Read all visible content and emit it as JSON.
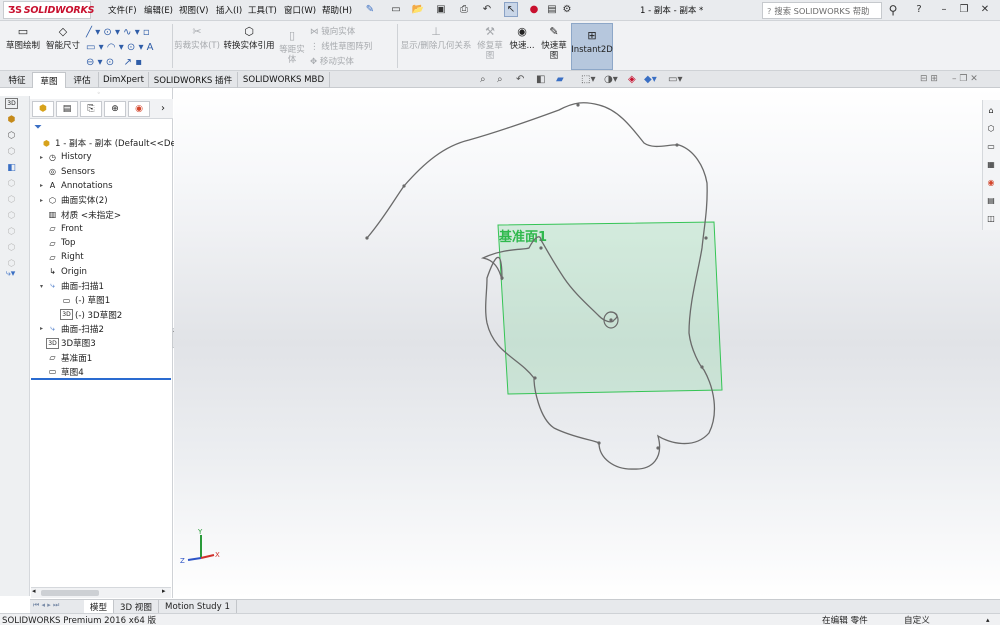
{
  "app": {
    "logo": "SOLIDWORKS",
    "doc_title": "1 - 副本 - 副本 *"
  },
  "menu": [
    "文件(F)",
    "编辑(E)",
    "视图(V)",
    "插入(I)",
    "工具(T)",
    "窗口(W)",
    "帮助(H)"
  ],
  "search": {
    "placeholder": "搜索 SOLIDWORKS 帮助"
  },
  "commands": {
    "sketch": "草图绘制",
    "smart_dim": "智能尺寸",
    "trim": "剪裁实体(T)",
    "convert": "转换实体引用",
    "offset": "等距实\n体",
    "offset_on_surface": "镜向实体",
    "linear_pattern": "线性草图阵列",
    "move": "移动实体",
    "display_relations": "显示/删除几何关系",
    "repair": "修复草\n图",
    "quick_snaps": "快速...",
    "rapid_sketch": "快速草\n图",
    "instant2d": "Instant2D"
  },
  "tabs": [
    "特征",
    "草图",
    "评估",
    "DimXpert",
    "SOLIDWORKS 插件",
    "SOLIDWORKS MBD"
  ],
  "active_tab": "草图",
  "tree": [
    {
      "label": "1 - 副本 - 副本  (Default<<Def...",
      "icon": "part-icon",
      "expand": ""
    },
    {
      "label": "History",
      "icon": "history-icon",
      "expand": "▸"
    },
    {
      "label": "Sensors",
      "icon": "sensor-icon",
      "expand": ""
    },
    {
      "label": "Annotations",
      "icon": "annotation-icon",
      "expand": "▸"
    },
    {
      "label": "曲面实体(2)",
      "icon": "surface-bodies-icon",
      "expand": "▸"
    },
    {
      "label": "材质 <未指定>",
      "icon": "material-icon",
      "expand": ""
    },
    {
      "label": "Front",
      "icon": "plane-icon",
      "expand": ""
    },
    {
      "label": "Top",
      "icon": "plane-icon",
      "expand": ""
    },
    {
      "label": "Right",
      "icon": "plane-icon",
      "expand": ""
    },
    {
      "label": "Origin",
      "icon": "origin-icon",
      "expand": ""
    },
    {
      "label": "曲面-扫描1",
      "icon": "sweep-icon",
      "expand": "▾"
    },
    {
      "label": "(-) 草图1",
      "icon": "sketch-icon",
      "expand": ""
    },
    {
      "label": "(-) 3D草图2",
      "icon": "3dsketch-icon",
      "expand": ""
    },
    {
      "label": "曲面-扫描2",
      "icon": "sweep-icon",
      "expand": "▸"
    },
    {
      "label": "3D草图3",
      "icon": "3dsketch-icon",
      "expand": ""
    },
    {
      "label": "基准面1",
      "icon": "plane-icon",
      "expand": ""
    },
    {
      "label": "草图4",
      "icon": "sketch-icon",
      "expand": ""
    }
  ],
  "viewport": {
    "plane_label": "基准面1",
    "triad": {
      "x": "X",
      "y": "Y",
      "z": "Z"
    }
  },
  "bottom_tabs": [
    "模型",
    "3D 视图",
    "Motion Study 1"
  ],
  "status": {
    "product": "SOLIDWORKS Premium 2016 x64 版",
    "editing": "在编辑 零件",
    "units": "自定义"
  },
  "colors": {
    "plane_fill": "#7fd99a",
    "plane_edge": "#35c455",
    "curve": "#6a6a6a",
    "logo_red": "#c8102e"
  }
}
